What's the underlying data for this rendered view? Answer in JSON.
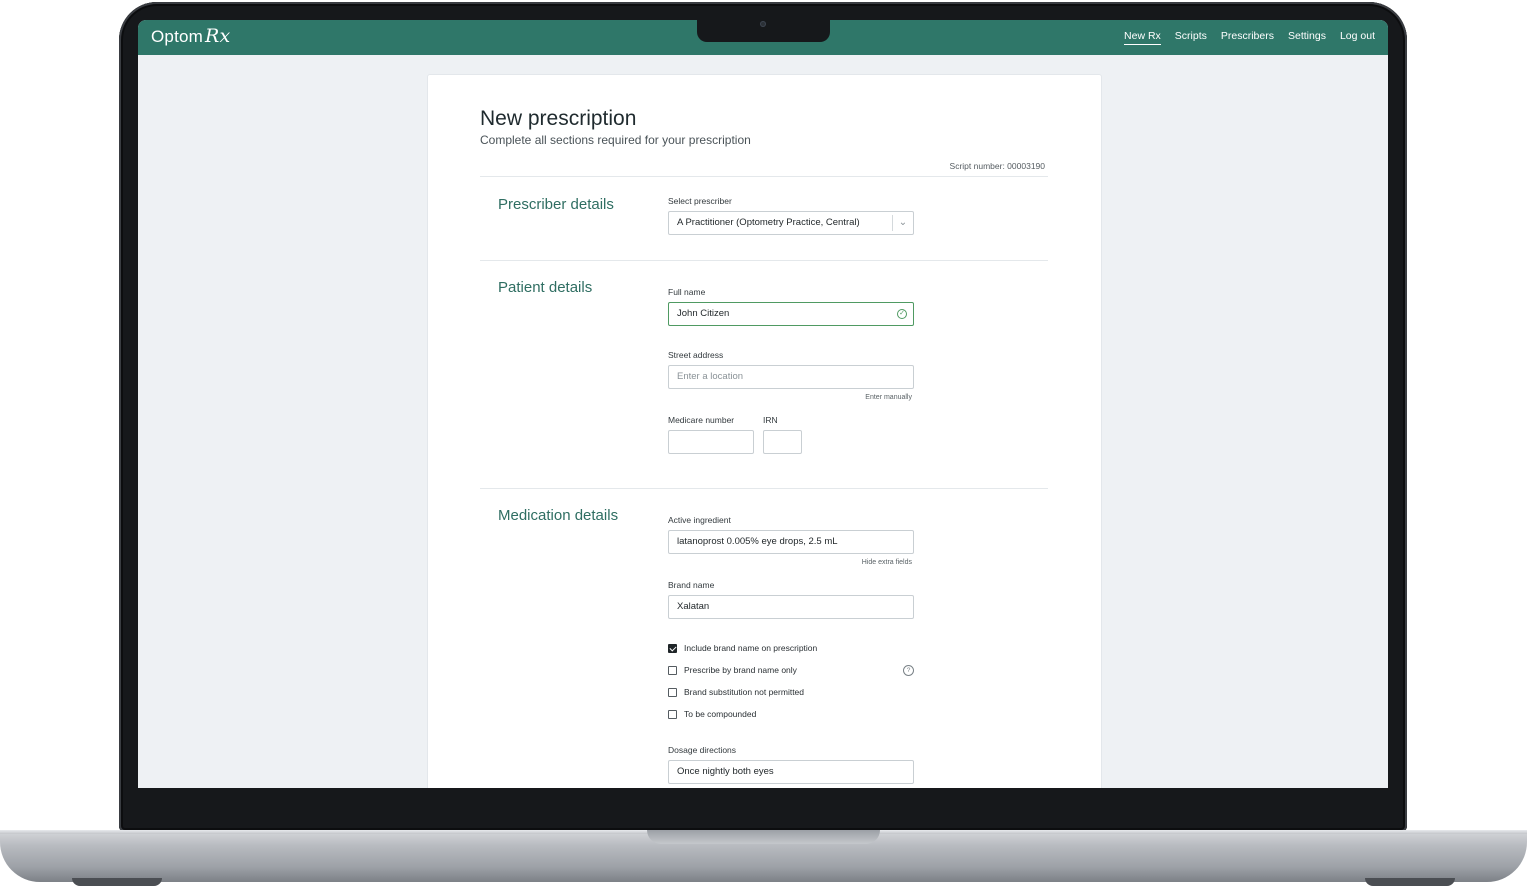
{
  "app": {
    "logo_text": "Optom",
    "logo_rx": "Rx"
  },
  "nav": {
    "items": [
      "New Rx",
      "Scripts",
      "Prescribers",
      "Settings",
      "Log out"
    ],
    "active": "New Rx"
  },
  "page": {
    "title": "New prescription",
    "subtitle": "Complete all sections required for your prescription",
    "script_number": "Script number: 00003190"
  },
  "prescriber": {
    "section_title": "Prescriber details",
    "select_label": "Select prescriber",
    "select_value": "A Practitioner (Optometry Practice, Central)"
  },
  "patient": {
    "section_title": "Patient details",
    "full_name_label": "Full name",
    "full_name_value": "John Citizen",
    "street_label": "Street address",
    "street_placeholder": "Enter a location",
    "enter_manually": "Enter manually",
    "medicare_label": "Medicare number",
    "irn_label": "IRN"
  },
  "medication": {
    "section_title": "Medication details",
    "active_label": "Active ingredient",
    "active_value": "latanoprost 0.005% eye drops, 2.5 mL",
    "hide_extra": "Hide extra fields",
    "brand_label": "Brand name",
    "brand_value": "Xalatan",
    "checkboxes": [
      {
        "label": "Include brand name on prescription",
        "checked": true
      },
      {
        "label": "Prescribe by brand name only",
        "checked": false
      },
      {
        "label": "Brand substitution not permitted",
        "checked": false
      },
      {
        "label": "To be compounded",
        "checked": false
      }
    ],
    "dosage_label": "Dosage directions",
    "dosage_value": "Once nightly both eyes"
  },
  "colors": {
    "brand": "#2f7769",
    "accent_text": "#2f6e62",
    "valid": "#4f9a62"
  },
  "icons": {
    "select_arrow": "chevron-down-icon",
    "valid": "check-circle-icon",
    "help": "question-circle-icon"
  }
}
